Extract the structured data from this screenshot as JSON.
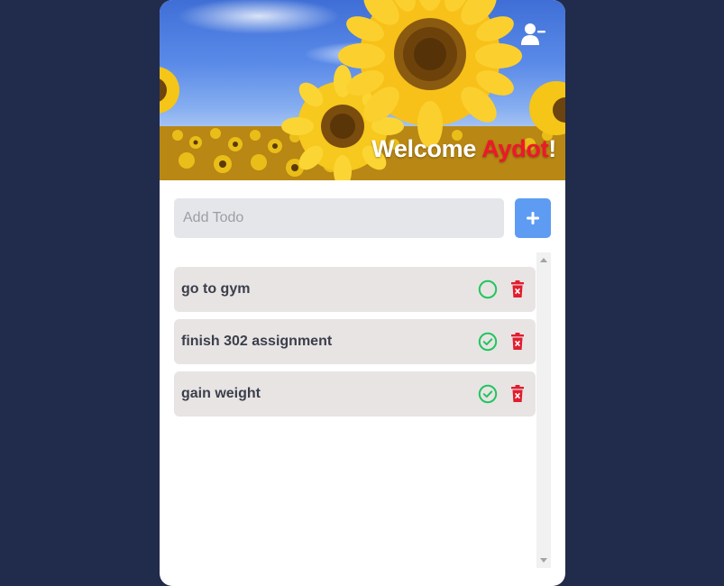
{
  "header": {
    "greeting": "Welcome ",
    "user_name": "Aydot",
    "exclamation": "!",
    "user_icon": "user-minus-icon",
    "name_color": "#f0162b"
  },
  "add_todo": {
    "placeholder": "Add Todo",
    "value": "",
    "button_icon": "plus-icon",
    "button_color": "#5e9cf3"
  },
  "todos": [
    {
      "text": "go to gym",
      "completed": false
    },
    {
      "text": "finish 302 assignment",
      "completed": true
    },
    {
      "text": "gain weight",
      "completed": true
    }
  ],
  "colors": {
    "background": "#212b4b",
    "check": "#22c55e",
    "delete": "#e11d2e",
    "todo_bg": "#e8e4e4"
  }
}
